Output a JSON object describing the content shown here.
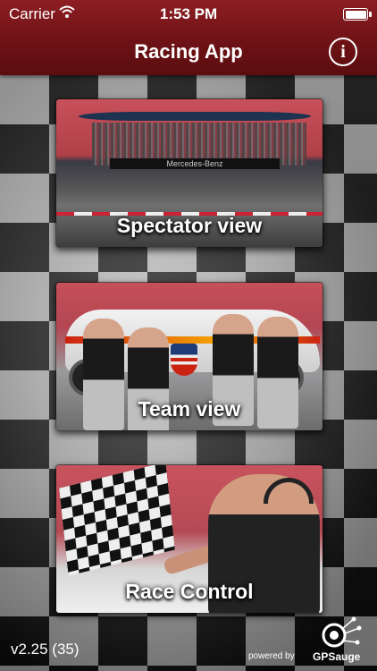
{
  "status_bar": {
    "carrier": "Carrier",
    "time": "1:53 PM",
    "battery_level": 1.0
  },
  "header": {
    "title": "Racing App",
    "info_icon": "info-circle-icon",
    "bar_color": "#7a1519"
  },
  "cards": [
    {
      "label": "Spectator view",
      "image": "grandstand-photo"
    },
    {
      "label": "Team view",
      "image": "race-team-photo"
    },
    {
      "label": "Race Control",
      "image": "race-marshal-checkered-flag-photo"
    }
  ],
  "footer": {
    "version": "v2.25 (35)",
    "powered_by": "powered by",
    "brand": "GPSauge"
  },
  "background": "checkered-flag-pattern"
}
